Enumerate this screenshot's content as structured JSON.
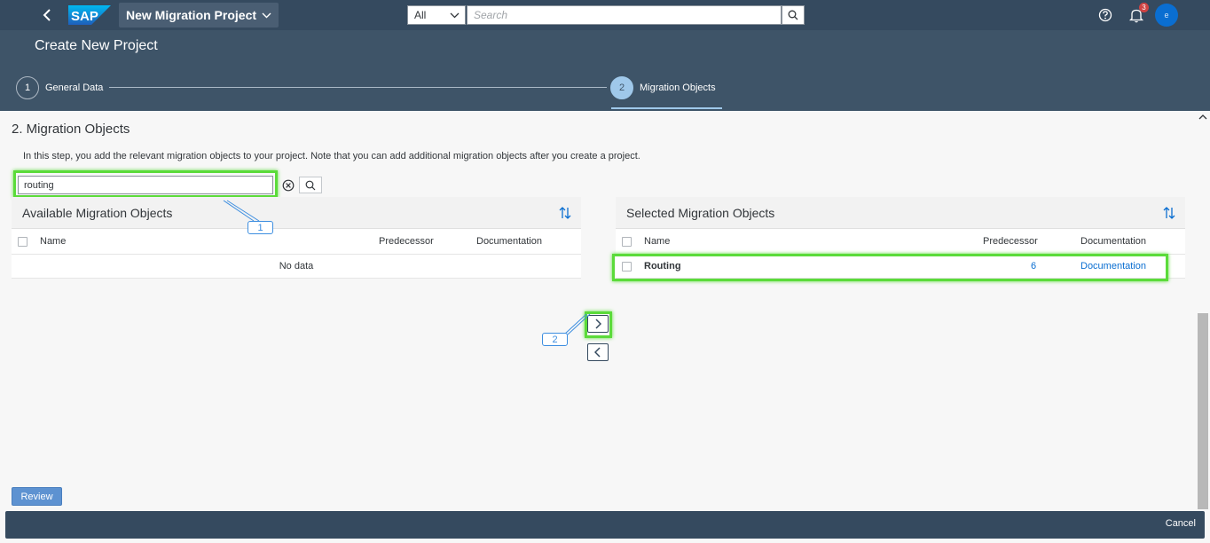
{
  "shell": {
    "logo_text": "SAP",
    "app_title": "New Migration Project",
    "scope_value": "All",
    "search_placeholder": "Search",
    "notifications_count": "3",
    "avatar_initial": "e"
  },
  "page": {
    "title": "Create New Project",
    "steps": [
      {
        "number": "1",
        "label": "General Data"
      },
      {
        "number": "2",
        "label": "Migration Objects"
      }
    ]
  },
  "section": {
    "title": "2. Migration Objects",
    "description": "In this step, you add the relevant migration objects to your project. Note that you can add additional migration objects after you create a project.",
    "filter_value": "routing"
  },
  "available": {
    "title": "Available Migration Objects",
    "columns": [
      "Name",
      "Predecessor",
      "Documentation"
    ],
    "empty_text": "No data"
  },
  "selected": {
    "title": "Selected Migration Objects",
    "columns": [
      "Name",
      "Predecessor",
      "Documentation"
    ],
    "rows": [
      {
        "name": "Routing",
        "predecessor": "6",
        "documentation": "Documentation"
      }
    ]
  },
  "callouts": [
    "1",
    "2"
  ],
  "actions": {
    "review": "Review",
    "cancel": "Cancel"
  },
  "colors": {
    "shell": "#354a5f",
    "header": "#3e5468",
    "highlight": "#5bdb3a",
    "link": "#0a6ed1"
  }
}
